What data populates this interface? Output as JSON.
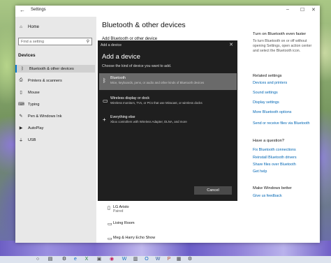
{
  "window": {
    "back_glyph": "←",
    "title": "Settings",
    "controls": [
      "–",
      "☐",
      "✕"
    ]
  },
  "sidebar": {
    "home_label": "Home",
    "search_placeholder": "Find a setting",
    "section_label": "Devices",
    "items": [
      {
        "label": "Bluetooth & other devices",
        "icon": "bluetooth-icon",
        "active": true
      },
      {
        "label": "Printers & scanners",
        "icon": "printer-icon"
      },
      {
        "label": "Mouse",
        "icon": "mouse-icon"
      },
      {
        "label": "Typing",
        "icon": "keyboard-icon"
      },
      {
        "label": "Pen & Windows Ink",
        "icon": "pen-icon"
      },
      {
        "label": "AutoPlay",
        "icon": "autoplay-icon"
      },
      {
        "label": "USB",
        "icon": "usb-icon"
      }
    ]
  },
  "main": {
    "title": "Bluetooth & other devices",
    "add_stub": "Add Bluetooth or other device",
    "devices": [
      {
        "name": "LG Aristo",
        "status": "Paired"
      },
      {
        "name": "Living Room",
        "status": ""
      },
      {
        "name": "Meg & Harry Echo Show",
        "status": ""
      }
    ]
  },
  "right": {
    "tip_heading": "Turn on Bluetooth even faster",
    "tip_text": "To turn Bluetooth on or off without opening Settings, open action center and select the Bluetooth icon.",
    "related_heading": "Related settings",
    "related_links": [
      "Devices and printers",
      "Sound settings",
      "Display settings",
      "More Bluetooth options",
      "Send or receive files via Bluetooth"
    ],
    "question_heading": "Have a question?",
    "question_links": [
      "Fix Bluetooth connections",
      "Reinstall Bluetooth drivers",
      "Share files over Bluetooth",
      "Get help"
    ],
    "better_heading": "Make Windows better",
    "better_link": "Give us feedback"
  },
  "dialog": {
    "window_title": "Add a device",
    "close_glyph": "✕",
    "heading": "Add a device",
    "subheading": "Choose the kind of device you want to add.",
    "options": [
      {
        "title": "Bluetooth",
        "desc": "Mice, keyboards, pens, or audio and other kinds of Bluetooth devices",
        "icon": "bluetooth-icon",
        "selected": true
      },
      {
        "title": "Wireless display or dock",
        "desc": "Wireless monitors, TVs, or PCs that use Miracast, or wireless docks",
        "icon": "monitor-icon",
        "selected": false
      },
      {
        "title": "Everything else",
        "desc": "Xbox controllers with Wireless Adapter, DLNA, and more",
        "icon": "plus-icon",
        "selected": false
      }
    ],
    "cancel_label": "Cancel"
  },
  "colors": {
    "accent": "#0078d4",
    "link": "#0066b4",
    "dialog_bg": "#1f1f1f",
    "selected_option": "#6a6a6a"
  }
}
